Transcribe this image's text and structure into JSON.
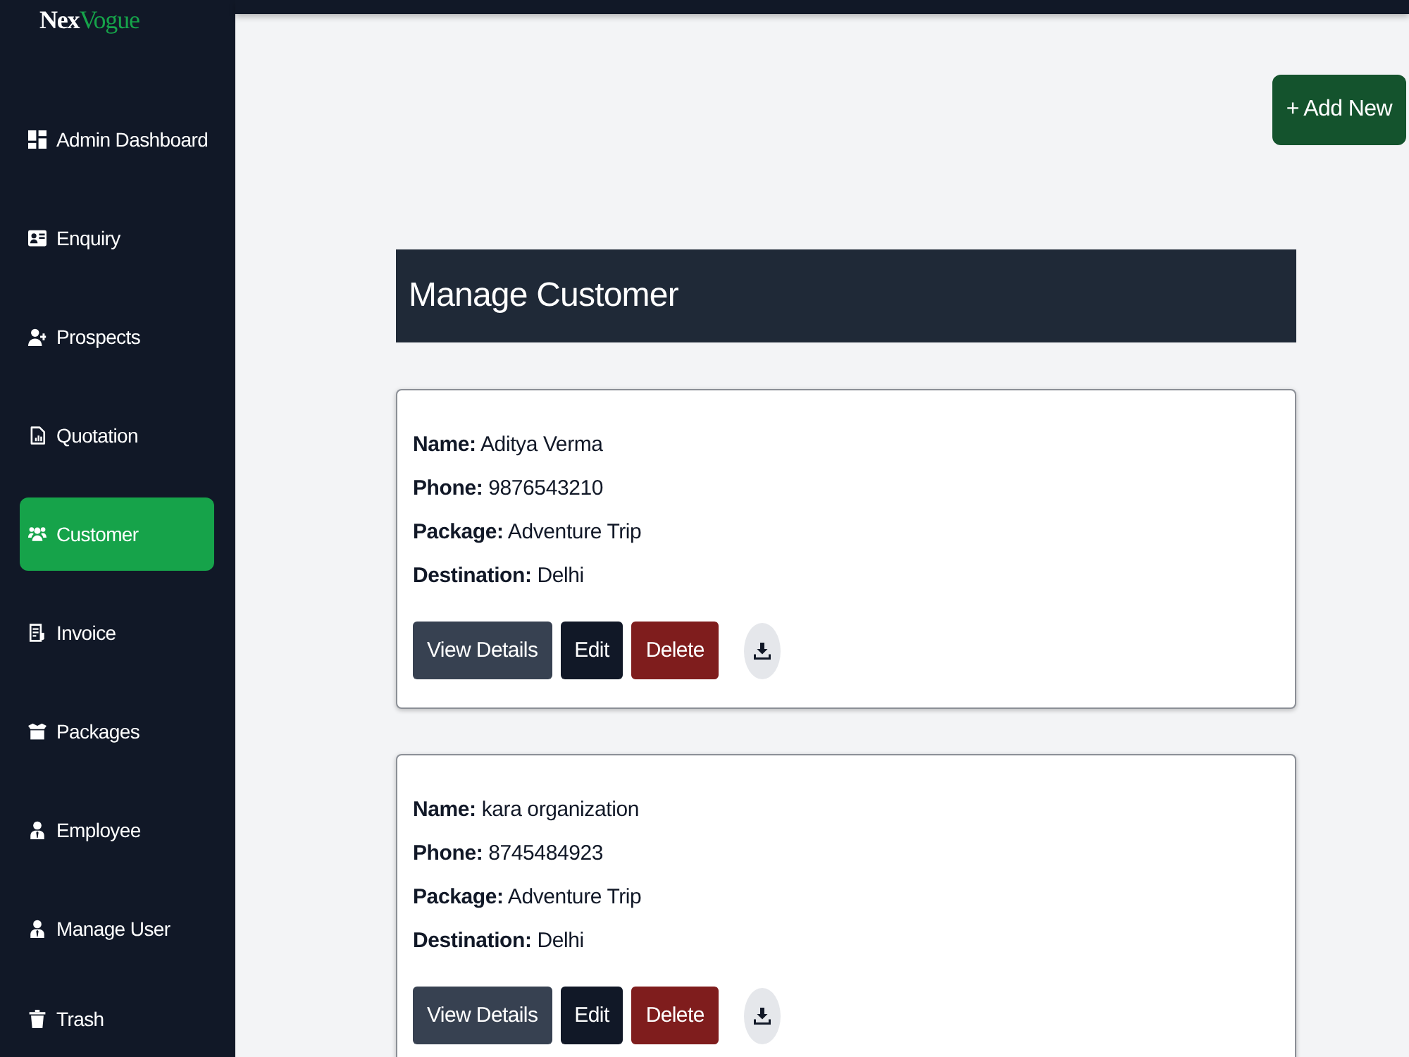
{
  "brand": {
    "first": "Nex",
    "second": "Vogue"
  },
  "sidebar": {
    "items": [
      {
        "label": "Admin Dashboard",
        "selected": false
      },
      {
        "label": "Enquiry",
        "selected": false
      },
      {
        "label": "Prospects",
        "selected": false
      },
      {
        "label": "Quotation",
        "selected": false
      },
      {
        "label": "Customer",
        "selected": true
      },
      {
        "label": "Invoice",
        "selected": false
      },
      {
        "label": "Packages",
        "selected": false
      },
      {
        "label": "Employee",
        "selected": false
      },
      {
        "label": "Manage User",
        "selected": false
      },
      {
        "label": "Trash",
        "selected": false
      }
    ]
  },
  "add_button": "+ Add New",
  "page_title": "Manage Customer",
  "customers": [
    {
      "lines": [
        "**Name:** Aditya Verma",
        "**Phone:** 9876543210",
        "**Package:** Adventure Trip",
        "**Destination:** Delhi"
      ],
      "actions": [
        {
          "label": "View Details",
          "kind": "view"
        },
        {
          "label": "Edit",
          "kind": "edit"
        },
        {
          "label": "Delete",
          "kind": "delete"
        }
      ]
    },
    {
      "lines": [
        "**Name:** kara organization",
        "**Phone:** 8745484923",
        "**Package:** Adventure Trip",
        "**Destination:** Delhi"
      ],
      "actions": [
        {
          "label": "View Details",
          "kind": "view"
        },
        {
          "label": "Edit",
          "kind": "edit"
        },
        {
          "label": "Delete",
          "kind": "delete"
        }
      ]
    }
  ]
}
